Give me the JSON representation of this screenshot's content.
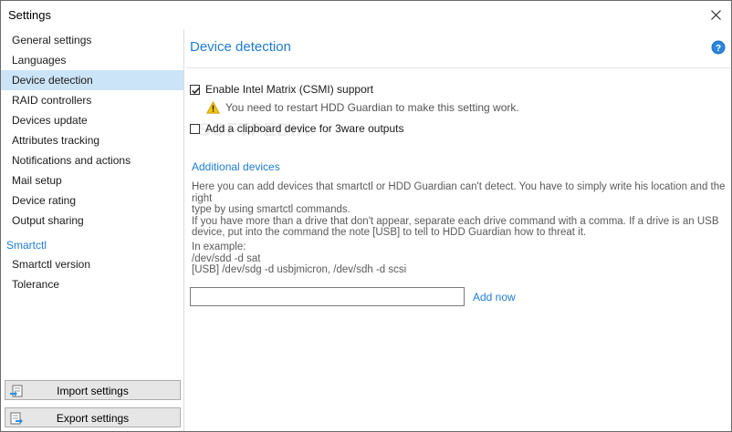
{
  "window": {
    "title": "Settings"
  },
  "sidebar": {
    "items": [
      {
        "label": "General settings"
      },
      {
        "label": "Languages"
      },
      {
        "label": "Device detection"
      },
      {
        "label": "RAID controllers"
      },
      {
        "label": "Devices update"
      },
      {
        "label": "Attributes tracking"
      },
      {
        "label": "Notifications and actions"
      },
      {
        "label": "Mail setup"
      },
      {
        "label": "Device rating"
      },
      {
        "label": "Output sharing"
      }
    ],
    "selected_item": "Device detection",
    "section_smartctl": "Smartctl",
    "smartctl_items": [
      {
        "label": "Smartctl version"
      },
      {
        "label": "Tolerance"
      }
    ],
    "import_button": "Import settings",
    "export_button": "Export settings"
  },
  "main": {
    "page_title": "Device detection",
    "enable_csmi": {
      "label": "Enable Intel Matrix (CSMI) support",
      "checked": true
    },
    "restart_warning": "You need to restart HDD Guardian to make this setting work.",
    "clipboard_3ware": {
      "label": "Add a clipboard device for 3ware outputs",
      "checked": false
    },
    "additional_devices": {
      "heading": "Additional devices",
      "description": "Here you can add devices that smartctl or HDD Guardian can't detect. You have to simply write his location and the right\ntype by using smartctl commands.\nIf you have more than a drive that don't appear, separate each drive command with a comma. If a drive is an USB\ndevice, put into the command the note [USB] to tell to HDD Guardian how to threat it.",
      "example": "In example:\n/dev/sdd -d sat\n[USB] /dev/sdg -d usbjmicron, /dev/sdh -d scsi",
      "input_value": "",
      "add_now": "Add now"
    }
  },
  "watermark": "SOFTPEDIA",
  "colors": {
    "accent": "#1e7bd3",
    "selected": "#cce4f7",
    "warning": "#f2c511"
  }
}
